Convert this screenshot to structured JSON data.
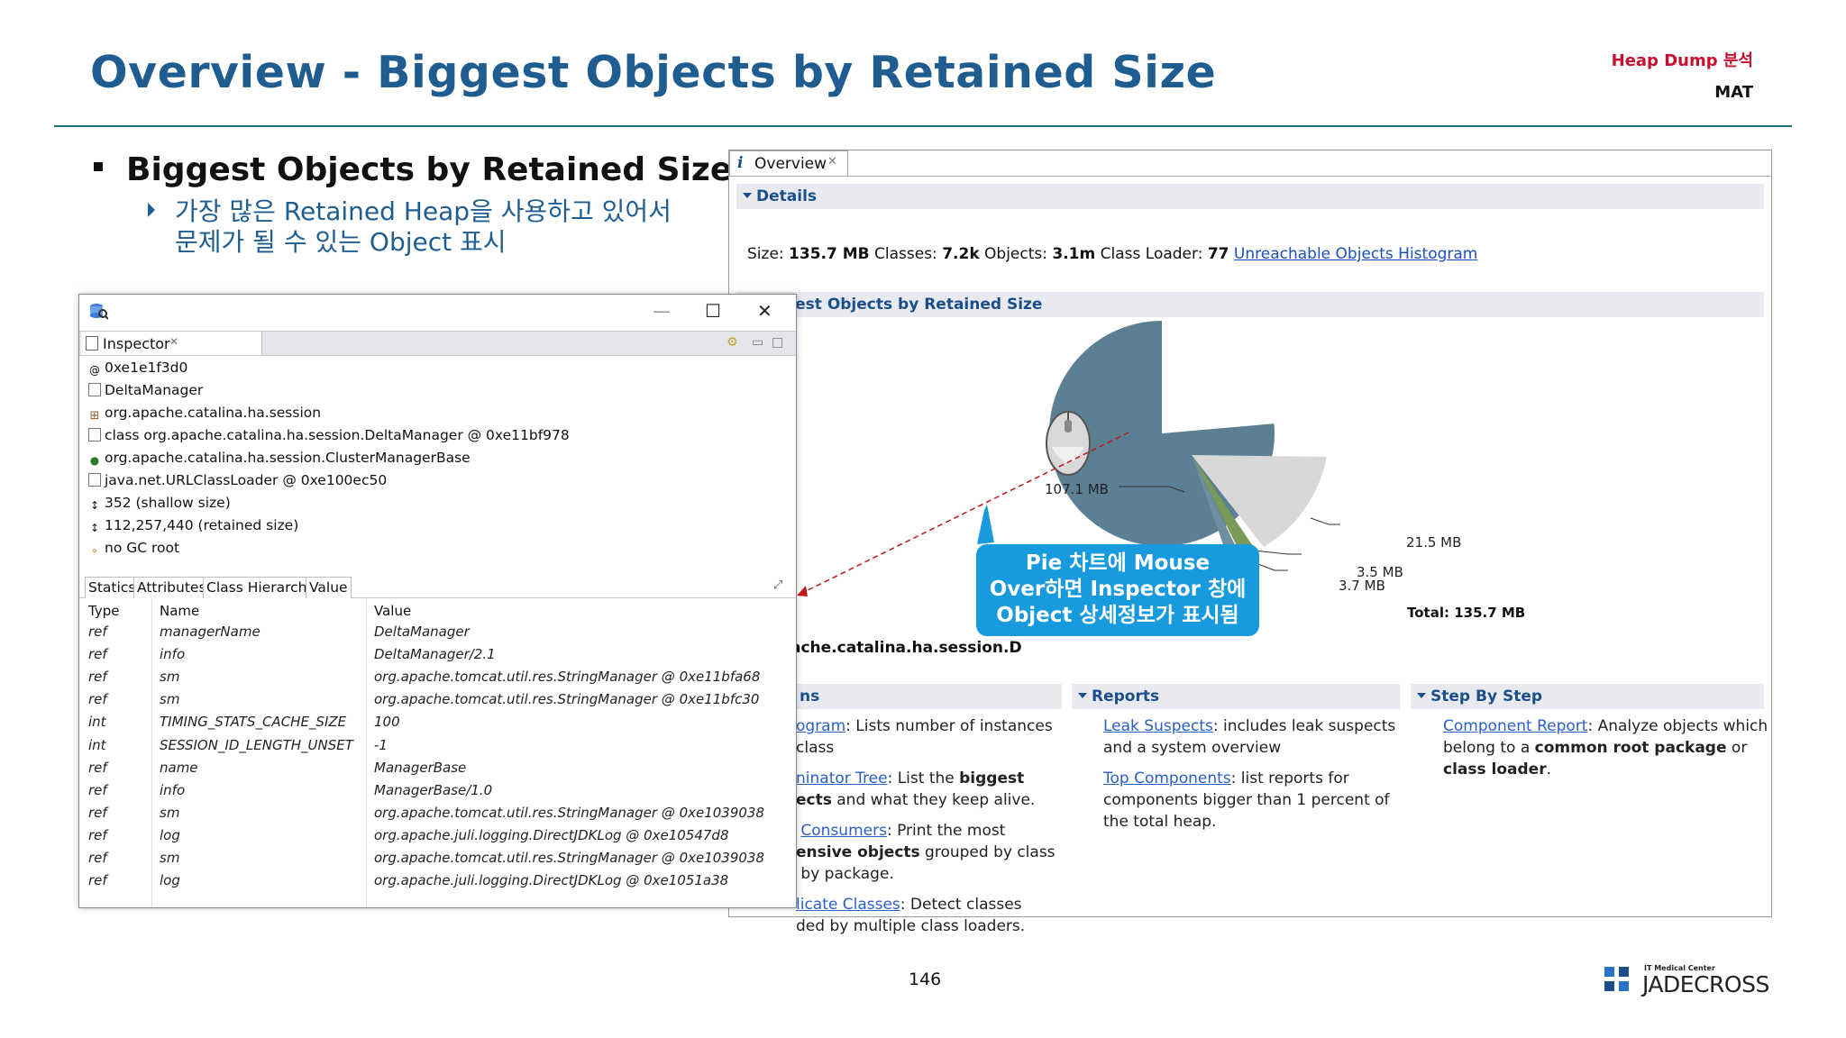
{
  "slide": {
    "title": "Overview - Biggest Objects by Retained Size",
    "header_right_1": "Heap Dump 분석",
    "header_right_2": "MAT",
    "bullet": "Biggest Objects by Retained Size",
    "sub_bullet_1": "가장 많은 Retained Heap을 사용하고 있어서",
    "sub_bullet_2": "문제가 될 수 있는 Object 표시",
    "page_number": "146",
    "logo_small": "IT Medical Center",
    "logo_big": "JADECROSS",
    "accent_color": "#1f5d91"
  },
  "overview": {
    "tab_label": "Overview",
    "details_header": "Details",
    "details": {
      "size_label": "Size:",
      "size_value": "135.7 MB",
      "classes_label": "Classes:",
      "classes_value": "7.2k",
      "objects_label": "Objects:",
      "objects_value": "3.1m",
      "loader_label": "Class Loader:",
      "loader_value": "77",
      "link": "Unreachable Objects Histogram"
    },
    "biggest_header": "Biggest Objects by Retained Size",
    "pie_labels": [
      "107.1 MB",
      "21.5 MB",
      "3.5 MB",
      "3.7 MB"
    ],
    "total": "Total: 135.7 MB",
    "cut_label": "ache.catalina.ha.session.D",
    "actions_header_partial": "ns",
    "reports_header": "Reports",
    "stepbystep_header": "Step By Step",
    "actions": {
      "a1_link": "ogram",
      "a1_text": ": Lists number of instances",
      "a1_text2": "class",
      "a2_link": "ninator Tree",
      "a2_text": ": List the ",
      "a2_bold": "biggest",
      "a2_bold2": "ects",
      "a2_text2": " and what they keep alive.",
      "a3_link": "Consumers",
      "a3_text": ": Print the most",
      "a3_bold": "ensive objects",
      "a3_text2": " grouped by class",
      "a3_text3": "by package.",
      "a4_link": "licate Classes",
      "a4_text": ": Detect classes",
      "a4_text2": "ded by multiple class loaders."
    },
    "reports": {
      "r1_link": "Leak Suspects",
      "r1_text": ": includes leak suspects",
      "r1_text2": "and a system overview",
      "r2_link": "Top Components",
      "r2_text": ": list reports for",
      "r2_text2": "components bigger than 1 percent of",
      "r2_text3": "the total heap."
    },
    "steps": {
      "s1_link": "Component Report",
      "s1_text": ": Analyze objects which",
      "s1_text2": "belong to a ",
      "s1_bold": "common root package",
      "s1_text3": " or",
      "s1_bold2": "class loader",
      "s1_text4": "."
    }
  },
  "callout": {
    "line1": "Pie 차트에 Mouse",
    "line2": "Over하면 Inspector 창에",
    "line3": "Object 상세정보가 표시됨"
  },
  "inspector": {
    "tab_label": "Inspector",
    "tree": [
      {
        "icon": "at-icon",
        "text": "0xe1e1f3d0"
      },
      {
        "icon": "file-icon",
        "text": "DeltaManager"
      },
      {
        "icon": "package-icon",
        "text": "org.apache.catalina.ha.session"
      },
      {
        "icon": "class-file-icon",
        "text": "class org.apache.catalina.ha.session.DeltaManager @ 0xe11bf978"
      },
      {
        "icon": "class-icon",
        "text": "org.apache.catalina.ha.session.ClusterManagerBase"
      },
      {
        "icon": "classloader-icon",
        "text": "java.net.URLClassLoader @ 0xe100ec50"
      },
      {
        "icon": "size-icon",
        "text": "352 (shallow size)"
      },
      {
        "icon": "size-icon",
        "text": "112,257,440 (retained size)"
      },
      {
        "icon": "gc-root-icon",
        "text": "no GC root"
      }
    ],
    "subtabs": [
      "Statics",
      "Attributes",
      "Class Hierarchy",
      "Value"
    ],
    "columns": [
      "Type",
      "Name",
      "Value"
    ],
    "rows": [
      [
        "ref",
        "managerName",
        "DeltaManager"
      ],
      [
        "ref",
        "info",
        "DeltaManager/2.1"
      ],
      [
        "ref",
        "sm",
        "org.apache.tomcat.util.res.StringManager @ 0xe11bfa68"
      ],
      [
        "ref",
        "sm",
        "org.apache.tomcat.util.res.StringManager @ 0xe11bfc30"
      ],
      [
        "int",
        "TIMING_STATS_CACHE_SIZE",
        "100"
      ],
      [
        "int",
        "SESSION_ID_LENGTH_UNSET",
        "-1"
      ],
      [
        "ref",
        "name",
        "ManagerBase"
      ],
      [
        "ref",
        "info",
        "ManagerBase/1.0"
      ],
      [
        "ref",
        "sm",
        "org.apache.tomcat.util.res.StringManager @ 0xe1039038"
      ],
      [
        "ref",
        "log",
        "org.apache.juli.logging.DirectJDKLog @ 0xe10547d8"
      ],
      [
        "ref",
        "sm",
        "org.apache.tomcat.util.res.StringManager @ 0xe1039038"
      ],
      [
        "ref",
        "log",
        "org.apache.juli.logging.DirectJDKLog @ 0xe1051a38"
      ]
    ]
  }
}
